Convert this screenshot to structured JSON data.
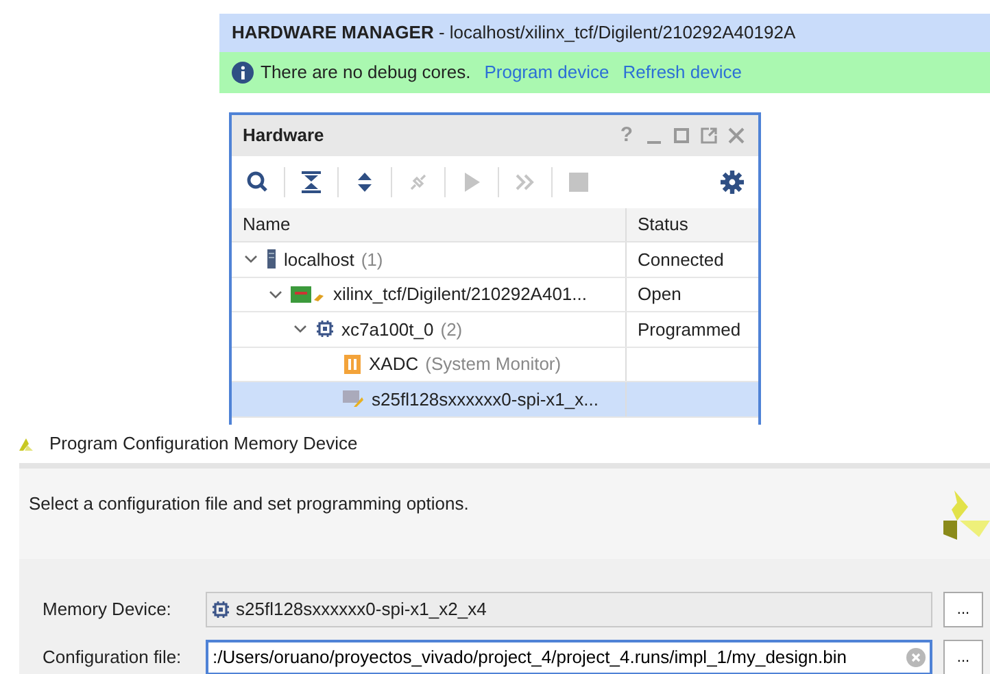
{
  "manager_header": {
    "title": "HARDWARE MANAGER",
    "path": " - localhost/xilinx_tcf/Digilent/210292A40192A"
  },
  "info_bar": {
    "message": "There are no debug cores.",
    "links": [
      "Program device",
      "Refresh device"
    ]
  },
  "hardware_panel": {
    "title": "Hardware",
    "window_buttons": [
      {
        "kind": "help",
        "label": "?"
      },
      {
        "kind": "minimize"
      },
      {
        "kind": "maximize"
      },
      {
        "kind": "undock"
      },
      {
        "kind": "close"
      }
    ],
    "toolbar": [
      {
        "kind": "search",
        "disabled": false
      },
      {
        "kind": "collapse",
        "disabled": false
      },
      {
        "kind": "expand",
        "disabled": false
      },
      {
        "kind": "connect",
        "disabled": true
      },
      {
        "kind": "run",
        "disabled": true
      },
      {
        "kind": "run-all",
        "disabled": true
      },
      {
        "kind": "stop",
        "disabled": true
      },
      {
        "kind": "settings",
        "disabled": false
      }
    ],
    "columns": [
      "Name",
      "Status"
    ],
    "tree": [
      {
        "kind": "server",
        "name": "localhost",
        "suffix": "(1)",
        "status": "Connected",
        "expanded": true,
        "selected": false,
        "children": [
          {
            "kind": "board",
            "name": "xilinx_tcf/Digilent/210292A401...",
            "status": "Open",
            "expanded": true,
            "selected": false,
            "children": [
              {
                "kind": "chip",
                "name": "xc7a100t_0",
                "suffix": "(2)",
                "status": "Programmed",
                "expanded": true,
                "selected": false,
                "children": [
                  {
                    "kind": "xadc",
                    "name": "XADC",
                    "suffix": "(System Monitor)",
                    "selected": false
                  },
                  {
                    "kind": "memory",
                    "name": "s25fl128sxxxxxx0-spi-x1_x...",
                    "selected": true
                  }
                ]
              }
            ]
          }
        ]
      }
    ]
  },
  "dialog": {
    "title": "Program Configuration Memory Device",
    "instruction": "Select a configuration file and set programming options.",
    "fields": [
      {
        "kind": "readonly",
        "label": "Memory Device:",
        "value": "s25fl128sxxxxxx0-spi-x1_x2_x4",
        "button": "..."
      },
      {
        "kind": "file",
        "label": "Configuration file:",
        "value": ":/Users/oruano/proyectos_vivado/project_4/project_4.runs/impl_1/my_design.bin",
        "button": "..."
      }
    ]
  }
}
